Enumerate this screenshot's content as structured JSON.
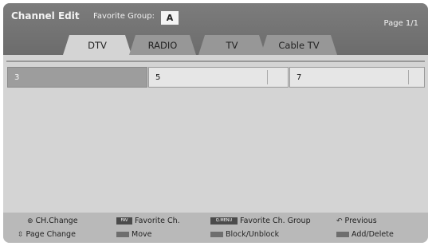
{
  "header": {
    "title": "Channel Edit",
    "favorite_label": "Favorite Group:",
    "favorite_value": "A",
    "page": "Page 1/1"
  },
  "tabs": [
    {
      "label": "DTV",
      "active": true
    },
    {
      "label": "RADIO",
      "active": false
    },
    {
      "label": "TV",
      "active": false
    },
    {
      "label": "Cable TV",
      "active": false
    }
  ],
  "channels": [
    {
      "number": "3",
      "selected": true
    },
    {
      "number": "5",
      "selected": false
    },
    {
      "number": "7",
      "selected": false
    }
  ],
  "footer": {
    "ch_change": "CH.Change",
    "fav_ch_key": "FAV",
    "fav_ch": "Favorite Ch.",
    "qmenu_key": "Q.MENU",
    "fav_group": "Favorite Ch. Group",
    "previous": "Previous",
    "page_change": "Page Change",
    "move": "Move",
    "block": "Block/Unblock",
    "add_delete": "Add/Delete"
  },
  "colors": {
    "header_bg": "#747474",
    "screen_bg": "#d4d4d4",
    "selected_cell": "#9d9d9d",
    "footer_bg": "#b9b9b9"
  }
}
